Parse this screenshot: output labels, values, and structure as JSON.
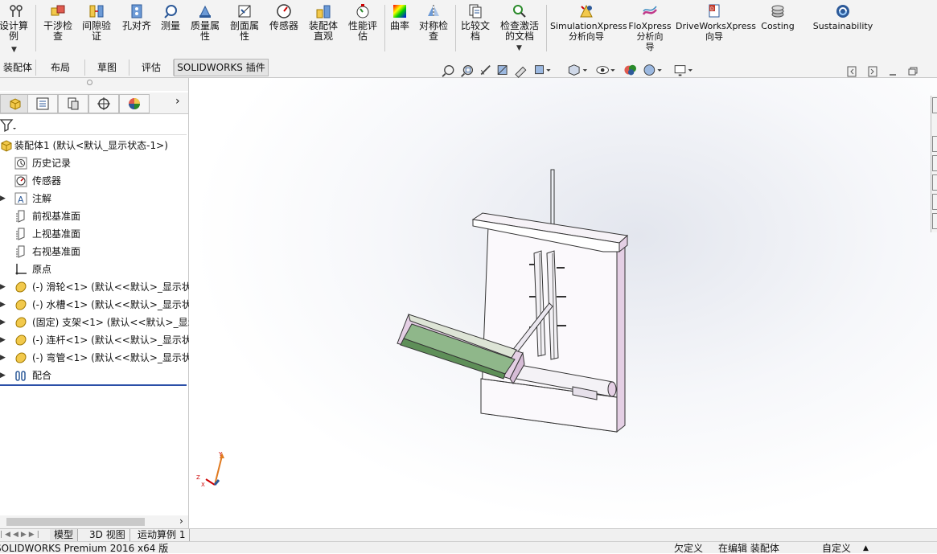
{
  "toolbar": {
    "buttons": [
      {
        "label": "设计算\n例"
      },
      {
        "label": "干涉检\n查"
      },
      {
        "label": "间隙验\n证"
      },
      {
        "label": "孔对齐"
      },
      {
        "label": "测量"
      },
      {
        "label": "质量属\n性"
      },
      {
        "label": "剖面属\n性"
      },
      {
        "label": "传感器"
      },
      {
        "label": "装配体\n直观"
      },
      {
        "label": "性能评\n估"
      },
      {
        "label": "曲率"
      },
      {
        "label": "对称检\n查"
      },
      {
        "label": "比较文\n档"
      },
      {
        "label": "检查激活\n的文档"
      },
      {
        "label": "SimulationXpress\n分析向导"
      },
      {
        "label": "FloXpress\n分析向\n导"
      },
      {
        "label": "DriveWorksXpress\n向导"
      },
      {
        "label": "Costing"
      },
      {
        "label": "Sustainability"
      }
    ]
  },
  "command_tabs": [
    "装配体",
    "布局",
    "草图",
    "评估",
    "SOLIDWORKS 插件"
  ],
  "tree": {
    "root": "装配体1  (默认<默认_显示状态-1>)",
    "items": [
      {
        "label": "历史记录",
        "icon": "history-icon"
      },
      {
        "label": "传感器",
        "icon": "sensor-icon"
      },
      {
        "label": "注解",
        "icon": "annotation-icon"
      },
      {
        "label": "前视基准面",
        "icon": "plane-icon"
      },
      {
        "label": "上视基准面",
        "icon": "plane-icon"
      },
      {
        "label": "右视基准面",
        "icon": "plane-icon"
      },
      {
        "label": "原点",
        "icon": "origin-icon"
      },
      {
        "label": "(-) 滑轮<1> (默认<<默认>_显示状",
        "icon": "part-icon"
      },
      {
        "label": "(-) 水槽<1> (默认<<默认>_显示状",
        "icon": "part-icon"
      },
      {
        "label": "(固定) 支架<1> (默认<<默认>_显示",
        "icon": "part-icon"
      },
      {
        "label": "(-) 连杆<1> (默认<<默认>_显示状",
        "icon": "part-icon"
      },
      {
        "label": "(-) 弯管<1> (默认<<默认>_显示状",
        "icon": "part-icon"
      },
      {
        "label": "配合",
        "icon": "mates-icon"
      }
    ]
  },
  "triad": {
    "x": "X",
    "y": "Y",
    "z": "Z"
  },
  "bottom_tabs": [
    "模型",
    "3D 视图",
    "运动算例 1"
  ],
  "status": {
    "app": "SOLIDWORKS Premium 2016 x64 版",
    "defined": "欠定义",
    "editing": "在编辑 装配体",
    "units": "自定义"
  },
  "colors": {
    "accent": "#2b4fa8",
    "tray_green": "#8fb78a",
    "part_pink": "#e4cfe4"
  }
}
